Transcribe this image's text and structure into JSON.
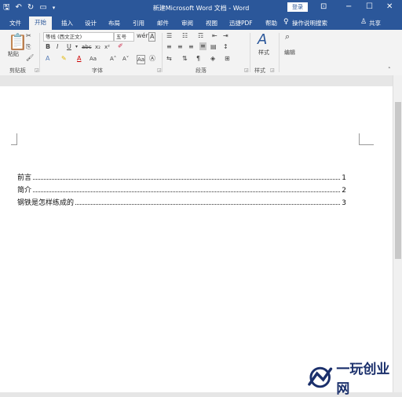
{
  "window": {
    "title": "新建Microsoft Word 文档 - Word",
    "login_label": "登录",
    "colors": {
      "title_bar": "#2b579a",
      "ribbon_bg": "#f3f3f3",
      "page_bg": "#ffffff"
    }
  },
  "quick_access": [
    "save-icon",
    "undo-icon",
    "redo-icon",
    "open-icon",
    "customize-icon"
  ],
  "tabs": [
    "文件",
    "开始",
    "插入",
    "设计",
    "布局",
    "引用",
    "邮件",
    "审阅",
    "视图",
    "迅捷PDF",
    "帮助"
  ],
  "active_tab": "开始",
  "tell_me": "操作说明搜索",
  "share": "共享",
  "ribbon": {
    "clipboard": {
      "paste": "粘贴",
      "label": "剪贴板"
    },
    "font": {
      "name": "等线 (西文正文)",
      "size": "五号",
      "label": "字体"
    },
    "paragraph": {
      "label": "段落"
    },
    "styles": {
      "button": "样式",
      "label": "样式"
    },
    "editing": {
      "button": "编辑"
    }
  },
  "toc": [
    {
      "title": "前言",
      "page": "1"
    },
    {
      "title": "简介",
      "page": "2"
    },
    {
      "title": "钢铁是怎样练成的",
      "page": "3"
    }
  ],
  "watermark": {
    "text": "一玩创业网"
  }
}
